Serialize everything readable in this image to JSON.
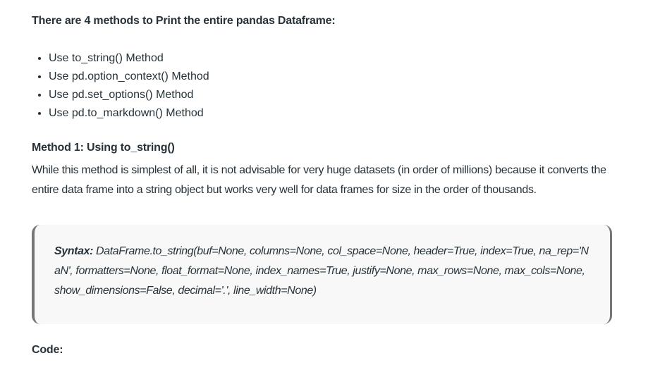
{
  "intro_heading": "There are 4 methods to Print the entire pandas Dataframe:",
  "methods": [
    "Use to_string() Method",
    "Use pd.option_context() Method",
    "Use pd.set_options() Method",
    "Use pd.to_markdown() Method"
  ],
  "method1": {
    "heading": "Method 1: Using to_string()",
    "paragraph": "While this method is simplest of all, it is not advisable for very huge datasets (in order of millions) because it converts the entire data frame into a string object but works very well for data frames for size in the order of thousands.",
    "syntax_label": "Syntax:",
    "syntax": "DataFrame.to_string(buf=None, columns=None, col_space=None, header=True, index=True, na_rep='NaN', formatters=None, float_format=None, index_names=True, justify=None, max_rows=None, max_cols=None, show_dimensions=False, decimal='.', line_width=None)"
  },
  "code_heading": "Code:"
}
